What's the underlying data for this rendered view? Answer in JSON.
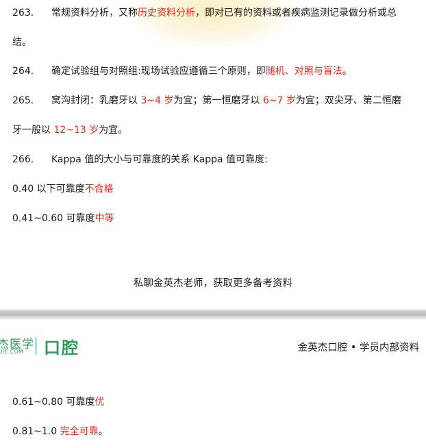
{
  "page1": {
    "item263": {
      "num": "263.",
      "line1": [
        "常规资料分析，又称",
        "历史资料分析",
        "，即对已有的资料或者疾病监测记录做分析或总"
      ],
      "line2": "结。"
    },
    "item264": {
      "num": "264.",
      "text": [
        "确定试验组与对照组:现场试验应遵循三个原则，即",
        "随机、对照与盲法",
        "。"
      ]
    },
    "item265": {
      "num": "265.",
      "line1": [
        "窝沟封闭：乳磨牙以 ",
        "3~4 岁",
        "为宜；第一恒磨牙以 ",
        "6~7 岁",
        "为宜；双尖牙、第二恒磨"
      ],
      "line2": [
        "牙一般以 ",
        "12~13 岁",
        "为宜。"
      ]
    },
    "item266": {
      "num": "266.",
      "text": "Kappa 值的大小与可靠度的关系 Kappa 值可靠度:"
    },
    "kappa1": [
      "0.40 以下可靠度",
      "不合格"
    ],
    "kappa2": [
      "0.41~0.60 可靠度",
      "中等"
    ],
    "footer_note": "私聊金英杰老师，获取更多备考资料"
  },
  "page2": {
    "logo_main": "杰医学",
    "logo_sub": "UIE.COM",
    "logo_product": "口腔",
    "header_right": "金英杰口腔 • 学员内部资料",
    "kappa3": [
      "0.61~0.80 可靠度",
      "优"
    ],
    "kappa4": [
      "0.81~1.0 ",
      "完全可靠",
      "。"
    ]
  },
  "colors": {
    "highlight": "#e52a1e",
    "brand_green": "#2f9a57"
  }
}
